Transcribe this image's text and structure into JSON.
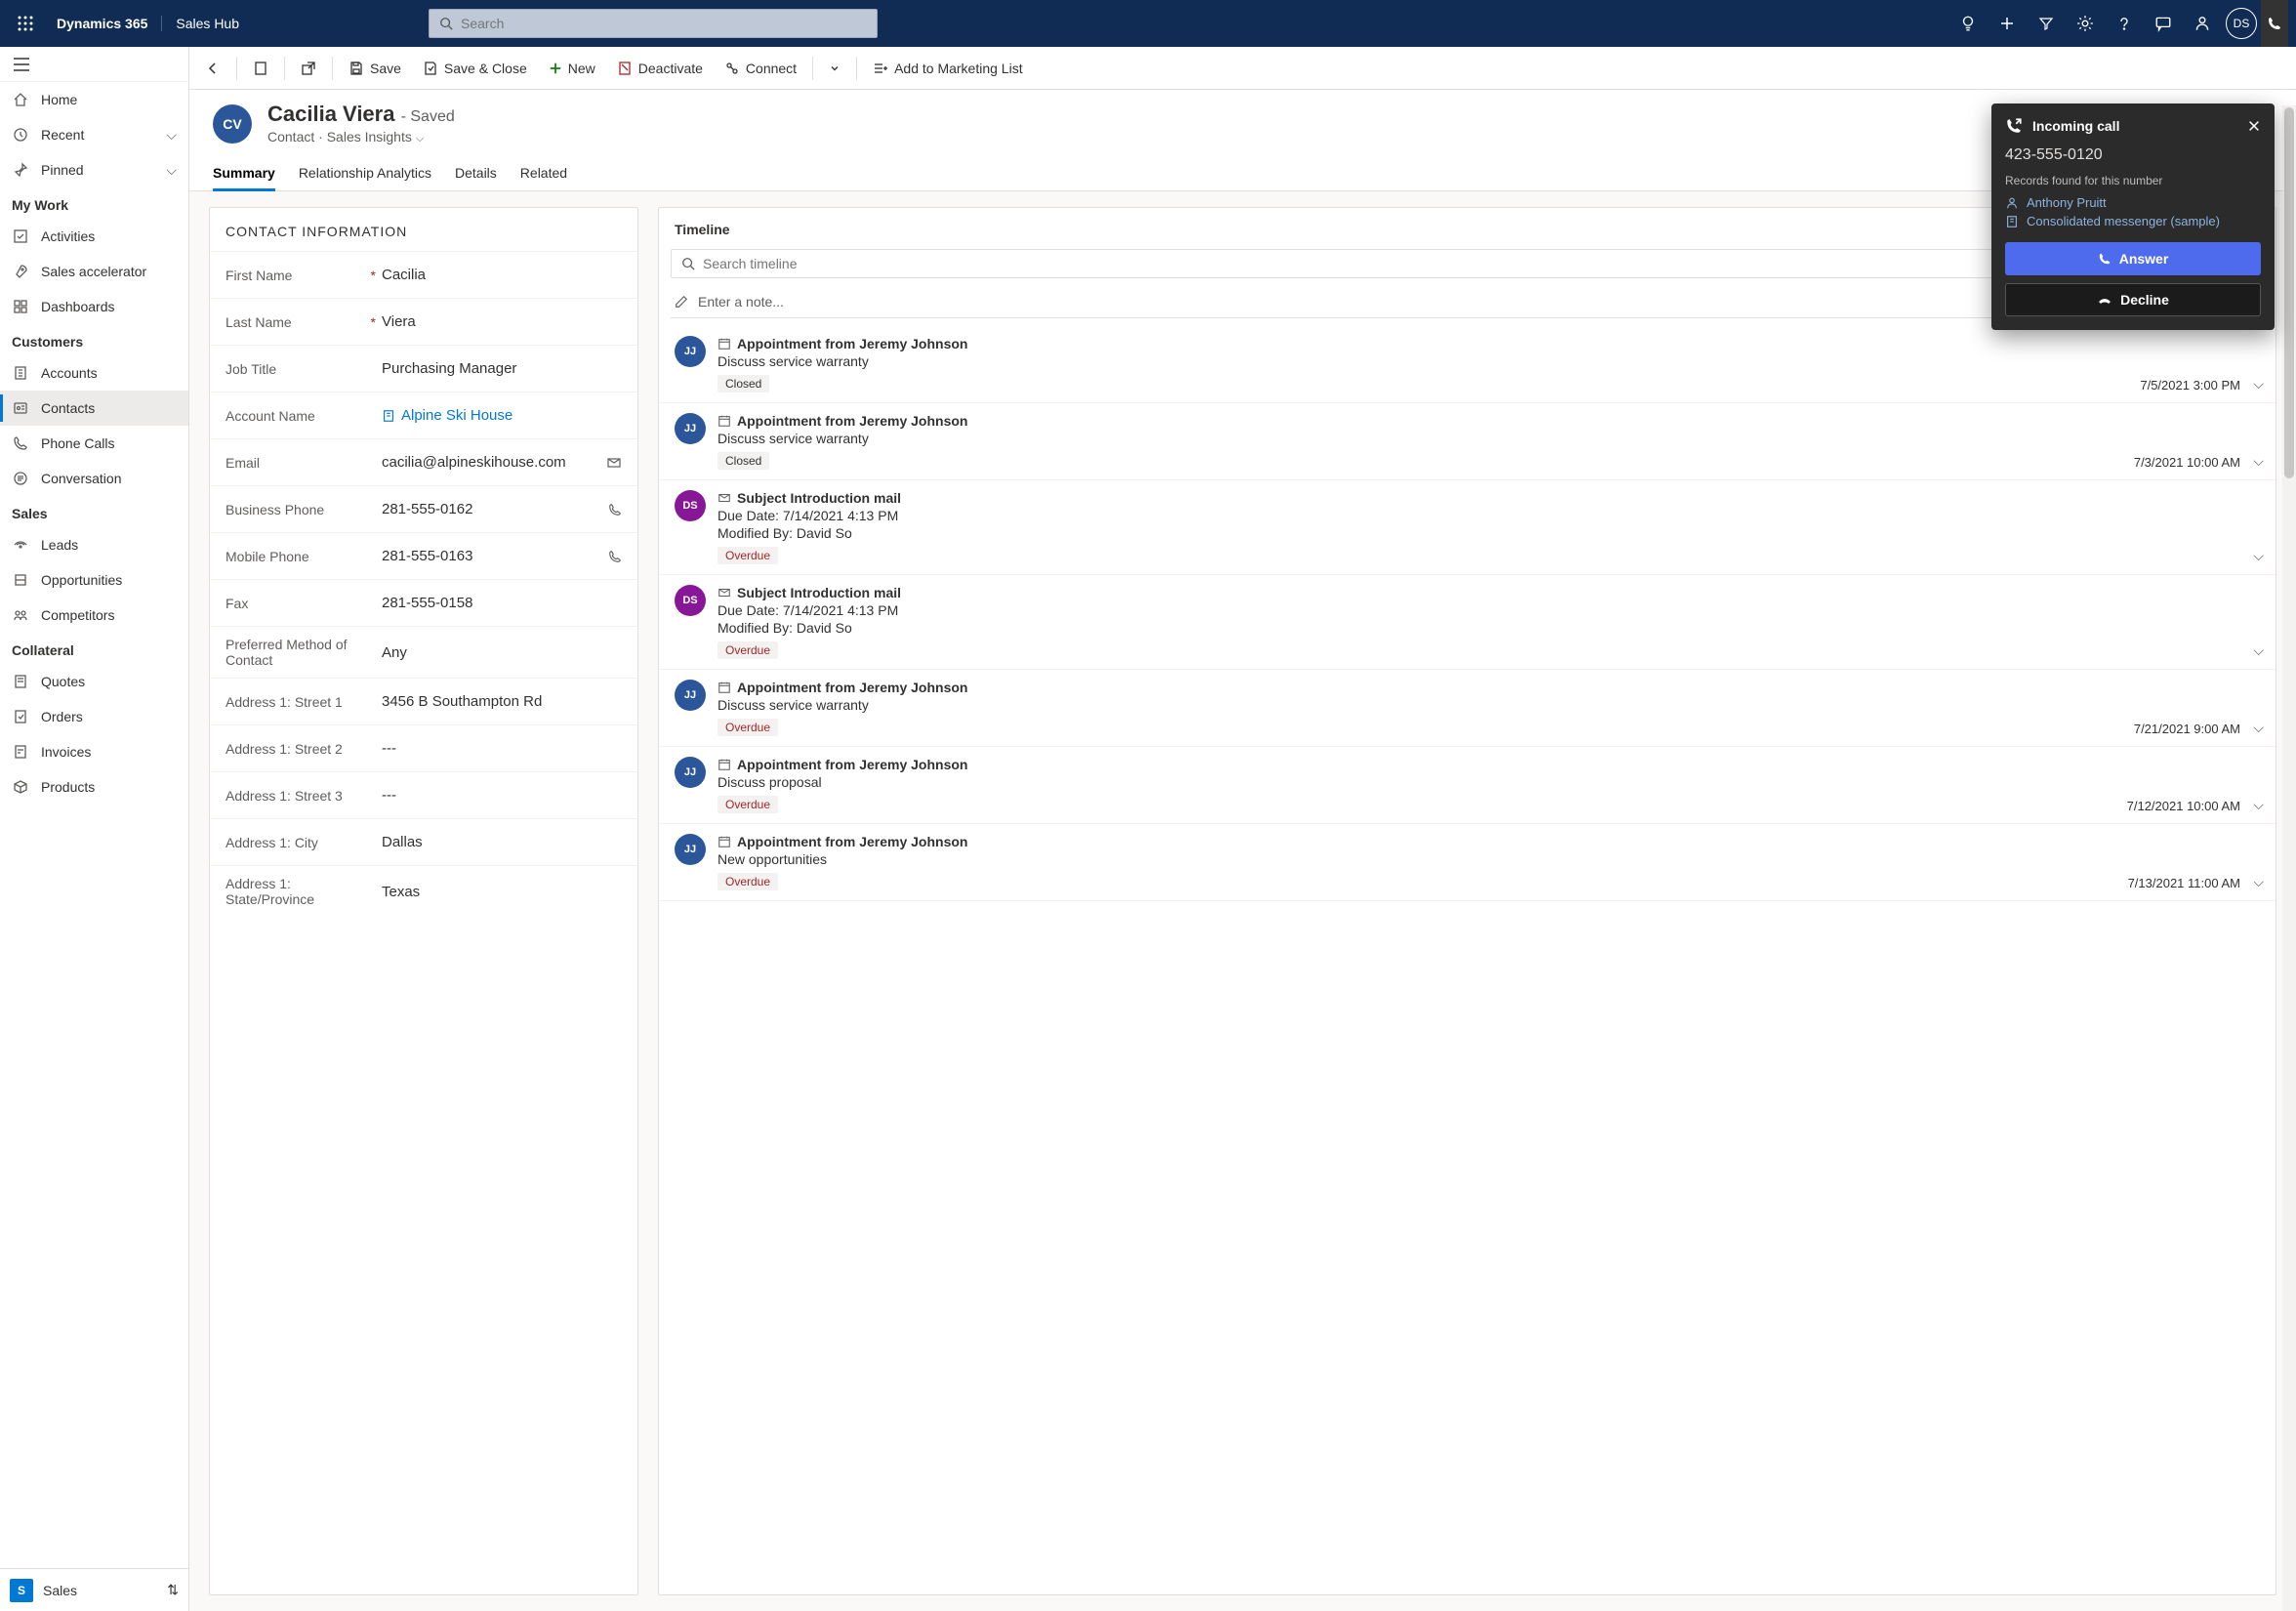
{
  "topbar": {
    "brand": "Dynamics 365",
    "hub": "Sales Hub",
    "search_placeholder": "Search",
    "avatar": "DS"
  },
  "sidebar": {
    "home": "Home",
    "recent": "Recent",
    "pinned": "Pinned",
    "sections": {
      "mywork": {
        "header": "My Work",
        "items": [
          "Activities",
          "Sales accelerator",
          "Dashboards"
        ]
      },
      "customers": {
        "header": "Customers",
        "items": [
          "Accounts",
          "Contacts",
          "Phone Calls",
          "Conversation"
        ]
      },
      "sales": {
        "header": "Sales",
        "items": [
          "Leads",
          "Opportunities",
          "Competitors"
        ]
      },
      "collateral": {
        "header": "Collateral",
        "items": [
          "Quotes",
          "Orders",
          "Invoices",
          "Products"
        ]
      }
    },
    "area": {
      "icon": "S",
      "label": "Sales"
    }
  },
  "cmdbar": {
    "save": "Save",
    "save_close": "Save & Close",
    "new": "New",
    "deactivate": "Deactivate",
    "connect": "Connect",
    "marketing": "Add to Marketing List"
  },
  "record": {
    "avatar": "CV",
    "name": "Cacilia Viera",
    "status": "- Saved",
    "entity": "Contact",
    "form": "Sales Insights"
  },
  "tabs": [
    "Summary",
    "Relationship Analytics",
    "Details",
    "Related"
  ],
  "contact_info": {
    "header": "CONTACT INFORMATION",
    "first_name": {
      "label": "First Name",
      "value": "Cacilia",
      "required": true
    },
    "last_name": {
      "label": "Last Name",
      "value": "Viera",
      "required": true
    },
    "job_title": {
      "label": "Job Title",
      "value": "Purchasing Manager"
    },
    "account": {
      "label": "Account Name",
      "value": "Alpine Ski House"
    },
    "email": {
      "label": "Email",
      "value": "cacilia@alpineskihouse.com"
    },
    "business_phone": {
      "label": "Business Phone",
      "value": "281-555-0162"
    },
    "mobile_phone": {
      "label": "Mobile Phone",
      "value": "281-555-0163"
    },
    "fax": {
      "label": "Fax",
      "value": "281-555-0158"
    },
    "preferred": {
      "label": "Preferred Method of Contact",
      "value": "Any"
    },
    "street1": {
      "label": "Address 1: Street 1",
      "value": "3456 B Southampton Rd"
    },
    "street2": {
      "label": "Address 1: Street 2",
      "value": "---"
    },
    "street3": {
      "label": "Address 1: Street 3",
      "value": "---"
    },
    "city": {
      "label": "Address 1: City",
      "value": "Dallas"
    },
    "state": {
      "label": "Address 1: State/Province",
      "value": "Texas"
    }
  },
  "timeline": {
    "header": "Timeline",
    "search_placeholder": "Search timeline",
    "note_placeholder": "Enter a note...",
    "items": [
      {
        "avatar": "JJ",
        "avclass": "jj",
        "icon": "calendar",
        "title": "Appointment from Jeremy Johnson",
        "desc": "Discuss service warranty",
        "badge": "Closed",
        "badgeclass": "",
        "ts": "7/5/2021 3:00 PM"
      },
      {
        "avatar": "JJ",
        "avclass": "jj",
        "icon": "calendar",
        "title": "Appointment from Jeremy Johnson",
        "desc": "Discuss service warranty",
        "badge": "Closed",
        "badgeclass": "",
        "ts": "7/3/2021 10:00 AM"
      },
      {
        "avatar": "DS",
        "avclass": "ds",
        "icon": "mail",
        "title": "Subject Introduction mail",
        "desc": "Due Date: 7/14/2021 4:13 PM",
        "desc2": "Modified By: David So",
        "badge": "Overdue",
        "badgeclass": "overdue",
        "ts": ""
      },
      {
        "avatar": "DS",
        "avclass": "ds",
        "icon": "mail",
        "title": "Subject Introduction mail",
        "desc": "Due Date: 7/14/2021 4:13 PM",
        "desc2": "Modified By: David So",
        "badge": "Overdue",
        "badgeclass": "overdue",
        "ts": ""
      },
      {
        "avatar": "JJ",
        "avclass": "jj",
        "icon": "calendar",
        "title": "Appointment from Jeremy Johnson",
        "desc": "Discuss service warranty",
        "badge": "Overdue",
        "badgeclass": "overdue",
        "ts": "7/21/2021 9:00 AM"
      },
      {
        "avatar": "JJ",
        "avclass": "jj",
        "icon": "calendar",
        "title": "Appointment from Jeremy Johnson",
        "desc": "Discuss proposal",
        "badge": "Overdue",
        "badgeclass": "overdue",
        "ts": "7/12/2021 10:00 AM"
      },
      {
        "avatar": "JJ",
        "avclass": "jj",
        "icon": "calendar",
        "title": "Appointment from Jeremy Johnson",
        "desc": "New opportunities",
        "badge": "Overdue",
        "badgeclass": "overdue",
        "ts": "7/13/2021 11:00 AM"
      }
    ]
  },
  "call": {
    "title": "Incoming call",
    "number": "423-555-0120",
    "found": "Records found for this number",
    "records": [
      {
        "icon": "person",
        "label": "Anthony Pruitt"
      },
      {
        "icon": "building",
        "label": "Consolidated messenger (sample)"
      }
    ],
    "answer": "Answer",
    "decline": "Decline"
  }
}
